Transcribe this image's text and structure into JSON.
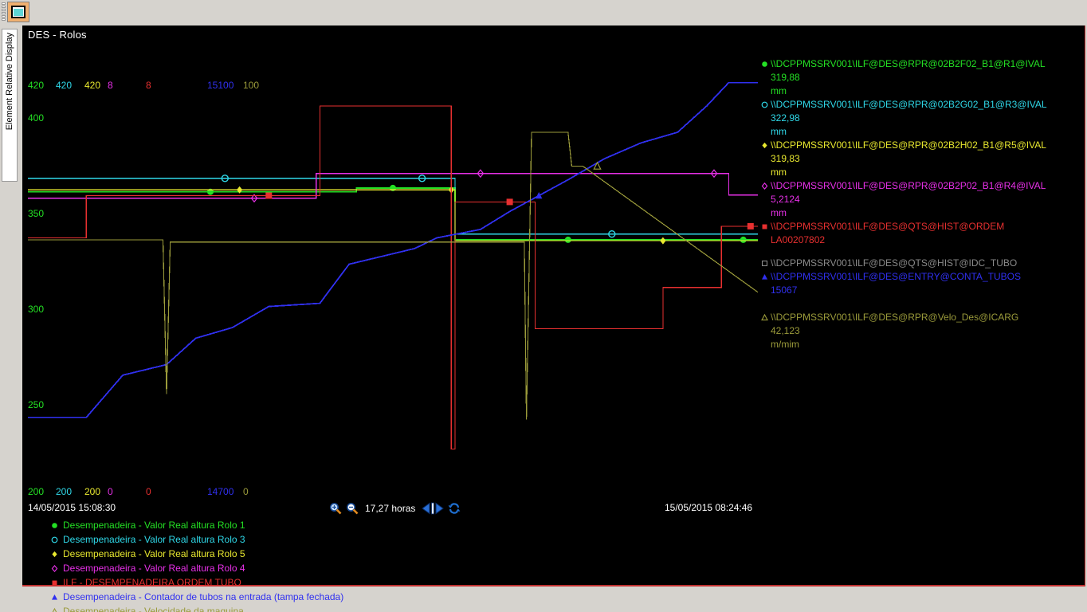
{
  "window": {
    "title": "DES - Rolos",
    "side_tab_label": "Element Relative Display",
    "toolbar_button_name": "trend-display-button"
  },
  "axis": {
    "y_labels": [
      "400",
      "350",
      "300",
      "250"
    ],
    "y_label_color": "#24e024",
    "scale_top": [
      {
        "text": "420",
        "color": "#24e024"
      },
      {
        "text": "420",
        "color": "#2fd8e8"
      },
      {
        "text": "420",
        "color": "#e8e82f"
      },
      {
        "text": "8",
        "color": "#e830e8"
      },
      {
        "text": "8",
        "color": "#e83030"
      },
      {
        "text": "15100",
        "color": "#3030f0"
      },
      {
        "text": "100",
        "color": "#9a9a3a"
      }
    ],
    "scale_bottom": [
      {
        "text": "200",
        "color": "#24e024"
      },
      {
        "text": "200",
        "color": "#2fd8e8"
      },
      {
        "text": "200",
        "color": "#e8e82f"
      },
      {
        "text": "0",
        "color": "#e830e8"
      },
      {
        "text": "0",
        "color": "#e83030"
      },
      {
        "text": "14700",
        "color": "#3030f0"
      },
      {
        "text": "0",
        "color": "#9a9a3a"
      }
    ]
  },
  "time": {
    "start": "14/05/2015 15:08:30",
    "end": "15/05/2015 08:24:46",
    "span_label": "17,27 horas",
    "zoom_in_icon": "zoom-in-icon",
    "zoom_out_icon": "zoom-out-icon",
    "pan_icon": "pan-left-right-icon",
    "refresh_icon": "refresh-icon"
  },
  "legend_right": [
    {
      "tag": "\\\\DCPPMSSRV001\\ILF@DES@RPR@02B2F02_B1@R1@IVAL",
      "value": "319,88",
      "unit": "mm",
      "color": "#24e024",
      "marker": "dot-filled"
    },
    {
      "tag": "\\\\DCPPMSSRV001\\ILF@DES@RPR@02B2G02_B1@R3@IVAL",
      "value": "322,98",
      "unit": "mm",
      "color": "#2fd8e8",
      "marker": "circle-open"
    },
    {
      "tag": "\\\\DCPPMSSRV001\\ILF@DES@RPR@02B2H02_B1@R5@IVAL",
      "value": "319,83",
      "unit": "mm",
      "color": "#e8e82f",
      "marker": "diamond-filled"
    },
    {
      "tag": "\\\\DCPPMSSRV001\\ILF@DES@RPR@02B2P02_B1@R4@IVAL",
      "value": "5,2124",
      "unit": "mm",
      "color": "#e830e8",
      "marker": "diamond-open"
    },
    {
      "tag": "\\\\DCPPMSSRV001\\ILF@DES@QTS@HIST@ORDEM",
      "value": "LA00207802",
      "unit": "",
      "color": "#e83030",
      "marker": "square-filled"
    },
    {
      "tag": "\\\\DCPPMSSRV001\\ILF@DES@QTS@HIST@IDC_TUBO",
      "value": "",
      "unit": "",
      "color": "#8a8a8a",
      "marker": "square-open"
    },
    {
      "tag": "\\\\DCPPMSSRV001\\ILF@DES@ENTRY@CONTA_TUBOS",
      "value": "15067",
      "unit": "",
      "color": "#3030f0",
      "marker": "triangle-filled"
    },
    {
      "tag": "\\\\DCPPMSSRV001\\ILF@DES@RPR@Velo_Des@ICARG",
      "value": "42,123",
      "unit": "m/mim",
      "color": "#9a9a3a",
      "marker": "triangle-open"
    }
  ],
  "legend_bottom": [
    {
      "label": "Desempenadeira - Valor Real altura Rolo 1",
      "color": "#24e024",
      "marker": "dot-filled"
    },
    {
      "label": "Desempenadeira - Valor Real altura Rolo 3",
      "color": "#2fd8e8",
      "marker": "circle-open"
    },
    {
      "label": "Desempenadeira - Valor Real altura Rolo 5",
      "color": "#e8e82f",
      "marker": "diamond-filled"
    },
    {
      "label": "Desempenadeira - Valor Real altura Rolo 4",
      "color": "#e830e8",
      "marker": "diamond-open"
    },
    {
      "label": "ILF - DESEMPENADEIRA ORDEM TUBO",
      "color": "#e83030",
      "marker": "square-filled"
    },
    {
      "label": "Desempenadeira - Contador de tubos na entrada (tampa fechada)",
      "color": "#3030f0",
      "marker": "triangle-filled"
    },
    {
      "label": "Desempenadeira - Velocidade da maquina",
      "color": "#9a9a3a",
      "marker": "triangle-open"
    }
  ],
  "chart_data": {
    "type": "line",
    "title": "DES - Rolos",
    "xlabel": "",
    "ylabel": "",
    "grid": false,
    "legend_position": "right",
    "x_axis": {
      "start": "14/05/2015 15:08:30",
      "end": "15/05/2015 08:24:46",
      "span_hours": 17.27
    },
    "series": [
      {
        "name": "Desempenadeira - Valor Real altura Rolo 1",
        "tag": "\\\\DCPPMSSRV001\\ILF@DES@RPR@02B2F02_B1@R1@IVAL",
        "color": "#24e024",
        "marker": "dot-filled",
        "unit": "mm",
        "current_value": 319.88,
        "ymin": 200,
        "ymax": 420,
        "points": [
          {
            "t": 0.0,
            "v": 345.0
          },
          {
            "t": 0.44,
            "v": 345.0
          },
          {
            "t": 0.45,
            "v": 347.0
          },
          {
            "t": 0.58,
            "v": 347.0
          },
          {
            "t": 0.585,
            "v": 320.0
          },
          {
            "t": 1.0,
            "v": 319.88
          }
        ]
      },
      {
        "name": "Desempenadeira - Valor Real altura Rolo 3",
        "tag": "\\\\DCPPMSSRV001\\ILF@DES@RPR@02B2G02_B1@R3@IVAL",
        "color": "#2fd8e8",
        "marker": "circle-open",
        "unit": "mm",
        "current_value": 322.98,
        "ymin": 200,
        "ymax": 420,
        "points": [
          {
            "t": 0.0,
            "v": 352.0
          },
          {
            "t": 0.58,
            "v": 352.0
          },
          {
            "t": 0.585,
            "v": 323.0
          },
          {
            "t": 1.0,
            "v": 322.98
          }
        ]
      },
      {
        "name": "Desempenadeira - Valor Real altura Rolo 5",
        "tag": "\\\\DCPPMSSRV001\\ILF@DES@RPR@02B2H02_B1@R5@IVAL",
        "color": "#e8e82f",
        "marker": "diamond-filled",
        "unit": "mm",
        "current_value": 319.83,
        "ymin": 200,
        "ymax": 420,
        "points": [
          {
            "t": 0.0,
            "v": 346.0
          },
          {
            "t": 0.58,
            "v": 346.0
          },
          {
            "t": 0.585,
            "v": 319.5
          },
          {
            "t": 1.0,
            "v": 319.83
          }
        ]
      },
      {
        "name": "Desempenadeira - Valor Real altura Rolo 4",
        "tag": "\\\\DCPPMSSRV001\\ILF@DES@RPR@02B2P02_B1@R4@IVAL",
        "color": "#e830e8",
        "marker": "diamond-open",
        "unit": "mm",
        "current_value": 5.2124,
        "ymin": 0,
        "ymax": 8,
        "points": [
          {
            "t": 0.0,
            "v": 5.15
          },
          {
            "t": 0.39,
            "v": 5.15
          },
          {
            "t": 0.395,
            "v": 5.62
          },
          {
            "t": 0.955,
            "v": 5.62
          },
          {
            "t": 0.96,
            "v": 5.21
          },
          {
            "t": 1.0,
            "v": 5.2124
          }
        ]
      },
      {
        "name": "ILF - DESEMPENADEIRA ORDEM TUBO",
        "tag": "\\\\DCPPMSSRV001\\ILF@DES@QTS@HIST@ORDEM",
        "color": "#e83030",
        "marker": "square-filled",
        "unit": "",
        "current_value": "LA00207802",
        "ymin": 0,
        "ymax": 8,
        "points": [
          {
            "t": 0.0,
            "v": 4.4
          },
          {
            "t": 0.075,
            "v": 4.4
          },
          {
            "t": 0.08,
            "v": 5.2
          },
          {
            "t": 0.395,
            "v": 5.2
          },
          {
            "t": 0.4,
            "v": 6.9
          },
          {
            "t": 0.575,
            "v": 6.9
          },
          {
            "t": 0.58,
            "v": 0.4
          },
          {
            "t": 0.585,
            "v": 5.08
          },
          {
            "t": 0.69,
            "v": 5.08
          },
          {
            "t": 0.695,
            "v": 2.68
          },
          {
            "t": 0.865,
            "v": 2.68
          },
          {
            "t": 0.87,
            "v": 3.46
          },
          {
            "t": 0.945,
            "v": 3.46
          },
          {
            "t": 0.95,
            "v": 4.62
          },
          {
            "t": 1.0,
            "v": 4.62
          }
        ]
      },
      {
        "name": "Desempenadeira - Contador de tubos na entrada (tampa fechada)",
        "tag": "\\\\DCPPMSSRV001\\ILF@DES@ENTRY@CONTA_TUBOS",
        "color": "#3030f0",
        "marker": "triangle-filled",
        "unit": "",
        "current_value": 15067,
        "ymin": 14700,
        "ymax": 15100,
        "points": [
          {
            "t": 0.0,
            "v": 14750
          },
          {
            "t": 0.08,
            "v": 14750
          },
          {
            "t": 0.13,
            "v": 14790
          },
          {
            "t": 0.19,
            "v": 14800
          },
          {
            "t": 0.23,
            "v": 14825
          },
          {
            "t": 0.28,
            "v": 14835
          },
          {
            "t": 0.33,
            "v": 14855
          },
          {
            "t": 0.4,
            "v": 14858
          },
          {
            "t": 0.44,
            "v": 14895
          },
          {
            "t": 0.53,
            "v": 14910
          },
          {
            "t": 0.56,
            "v": 14920
          },
          {
            "t": 0.62,
            "v": 14928
          },
          {
            "t": 0.66,
            "v": 14945
          },
          {
            "t": 0.7,
            "v": 14960
          },
          {
            "t": 0.74,
            "v": 14975
          },
          {
            "t": 0.79,
            "v": 14995
          },
          {
            "t": 0.84,
            "v": 15010
          },
          {
            "t": 0.89,
            "v": 15020
          },
          {
            "t": 0.93,
            "v": 15045
          },
          {
            "t": 0.96,
            "v": 15067
          },
          {
            "t": 1.0,
            "v": 15067
          }
        ]
      },
      {
        "name": "Desempenadeira - Velocidade da maquina",
        "tag": "\\\\DCPPMSSRV001\\ILF@DES@RPR@Velo_Des@ICARG",
        "color": "#9a9a3a",
        "marker": "triangle-open",
        "unit": "m/mim",
        "current_value": 42.123,
        "ymin": 0,
        "ymax": 100,
        "points": [
          {
            "t": 0.0,
            "v": 54.5
          },
          {
            "t": 0.185,
            "v": 54.5
          },
          {
            "t": 0.19,
            "v": 18.0
          },
          {
            "t": 0.195,
            "v": 54.0
          },
          {
            "t": 0.29,
            "v": 54.0
          },
          {
            "t": 0.68,
            "v": 54.0
          },
          {
            "t": 0.683,
            "v": 12.0
          },
          {
            "t": 0.69,
            "v": 80.0
          },
          {
            "t": 0.7,
            "v": 80.0
          },
          {
            "t": 0.74,
            "v": 80.0
          },
          {
            "t": 0.745,
            "v": 72.0
          },
          {
            "t": 0.76,
            "v": 72.0
          },
          {
            "t": 1.0,
            "v": 42.123
          }
        ]
      }
    ]
  }
}
